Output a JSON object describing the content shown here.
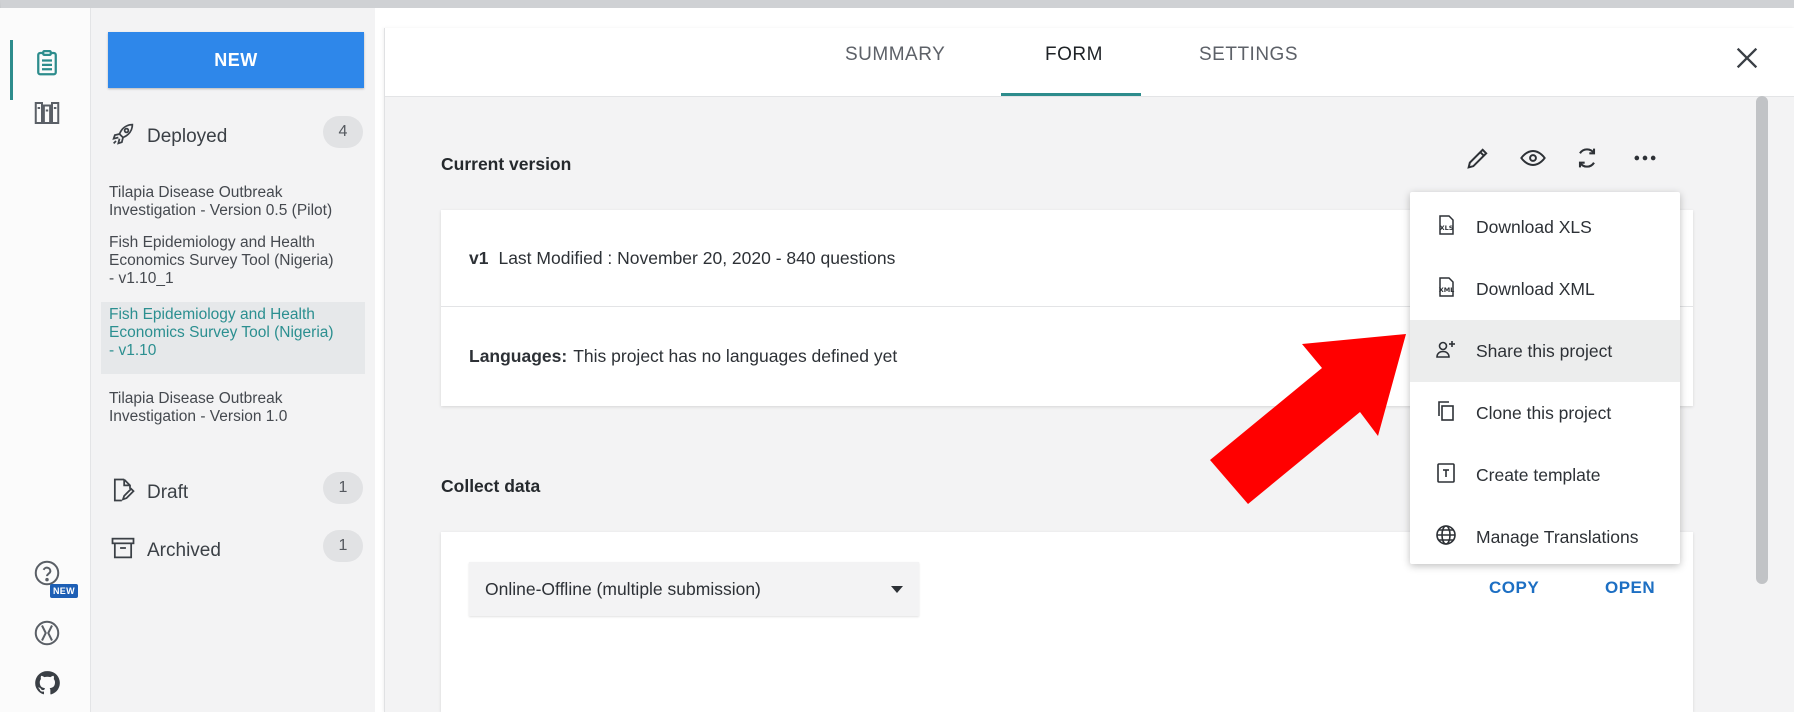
{
  "sidebar": {
    "new_label": "NEW",
    "deployed": {
      "label": "Deployed",
      "count": "4"
    },
    "draft": {
      "label": "Draft",
      "count": "1"
    },
    "archived": {
      "label": "Archived",
      "count": "1"
    },
    "projects": [
      {
        "line1": "Tilapia Disease Outbreak",
        "line2": "Investigation - Version 0.5 (Pilot)",
        "line3": ""
      },
      {
        "line1": "Fish Epidemiology and Health",
        "line2": "Economics Survey Tool (Nigeria)",
        "line3": "- v1.10_1"
      },
      {
        "line1": "Fish Epidemiology and Health",
        "line2": "Economics Survey Tool (Nigeria)",
        "line3": "- v1.10"
      },
      {
        "line1": "Tilapia Disease Outbreak",
        "line2": "Investigation - Version 1.0",
        "line3": ""
      }
    ]
  },
  "rail": {
    "new_badge": "NEW"
  },
  "tabs": {
    "summary": "SUMMARY",
    "form": "FORM",
    "settings": "SETTINGS",
    "active": "FORM"
  },
  "current_version": {
    "title": "Current version",
    "version": "v1",
    "modified": "Last Modified : November 20, 2020 - 840 questions",
    "languages_label": "Languages:",
    "languages_value": "This project has no languages defined yet"
  },
  "collect": {
    "title": "Collect data",
    "select_value": "Online-Offline (multiple submission)",
    "copy_label": "COPY",
    "open_label": "OPEN"
  },
  "menu": {
    "download_xls": "Download XLS",
    "download_xml": "Download XML",
    "share": "Share this project",
    "clone": "Clone this project",
    "template": "Create template",
    "translations": "Manage Translations"
  },
  "colors": {
    "accent": "#2d8c8c",
    "primary_button": "#2e87ea",
    "link": "#1d6fc3",
    "annotation_arrow": "#ff0000"
  }
}
